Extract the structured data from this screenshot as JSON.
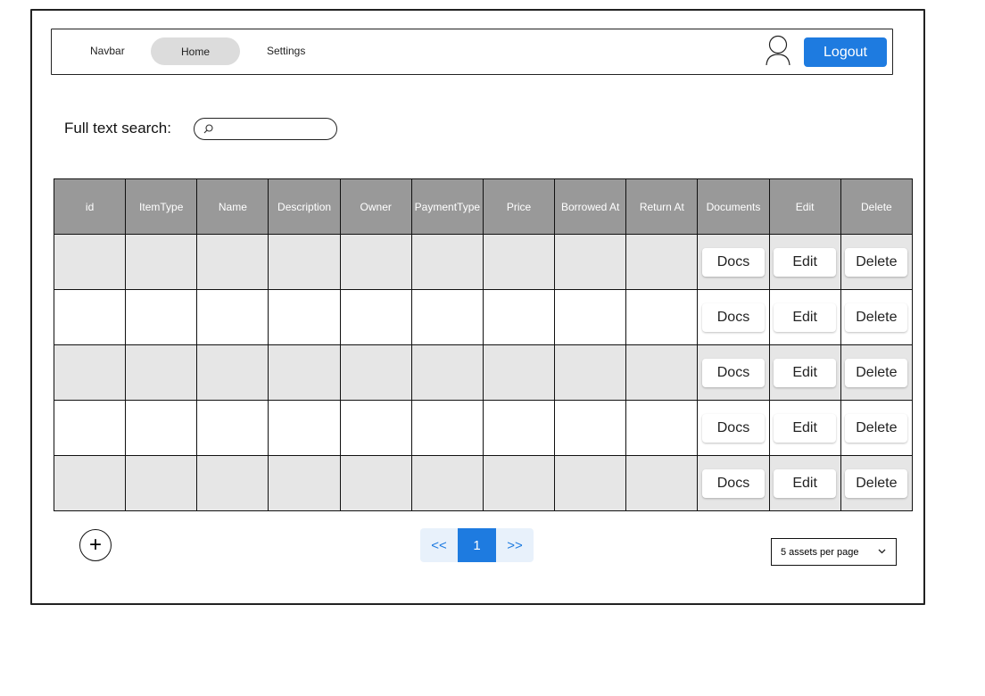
{
  "navbar": {
    "brand": "Navbar",
    "home": "Home",
    "settings": "Settings",
    "avatar_icon": "user-icon",
    "logout": "Logout",
    "logout_color": "#1e7be0"
  },
  "search": {
    "label": "Full text search:",
    "value": "",
    "placeholder": "",
    "icon": "search-icon"
  },
  "table": {
    "columns": [
      "id",
      "ItemType",
      "Name",
      "Description",
      "Owner",
      "PaymentType",
      "Price",
      "Borrowed At",
      "Return At",
      "Documents",
      "Edit",
      "Delete"
    ],
    "header_color": "#999999",
    "rows": [
      {
        "docs": "Docs",
        "edit": "Edit",
        "delete": "Delete"
      },
      {
        "docs": "Docs",
        "edit": "Edit",
        "delete": "Delete"
      },
      {
        "docs": "Docs",
        "edit": "Edit",
        "delete": "Delete"
      },
      {
        "docs": "Docs",
        "edit": "Edit",
        "delete": "Delete"
      },
      {
        "docs": "Docs",
        "edit": "Edit",
        "delete": "Delete"
      }
    ]
  },
  "add_button": {
    "icon": "plus-icon",
    "label": "+"
  },
  "pagination": {
    "prev": "<<",
    "current": "1",
    "next": ">>",
    "accent": "#1e7be0"
  },
  "per_page": {
    "selected": "5 assets per page",
    "icon": "chevron-down-icon"
  }
}
